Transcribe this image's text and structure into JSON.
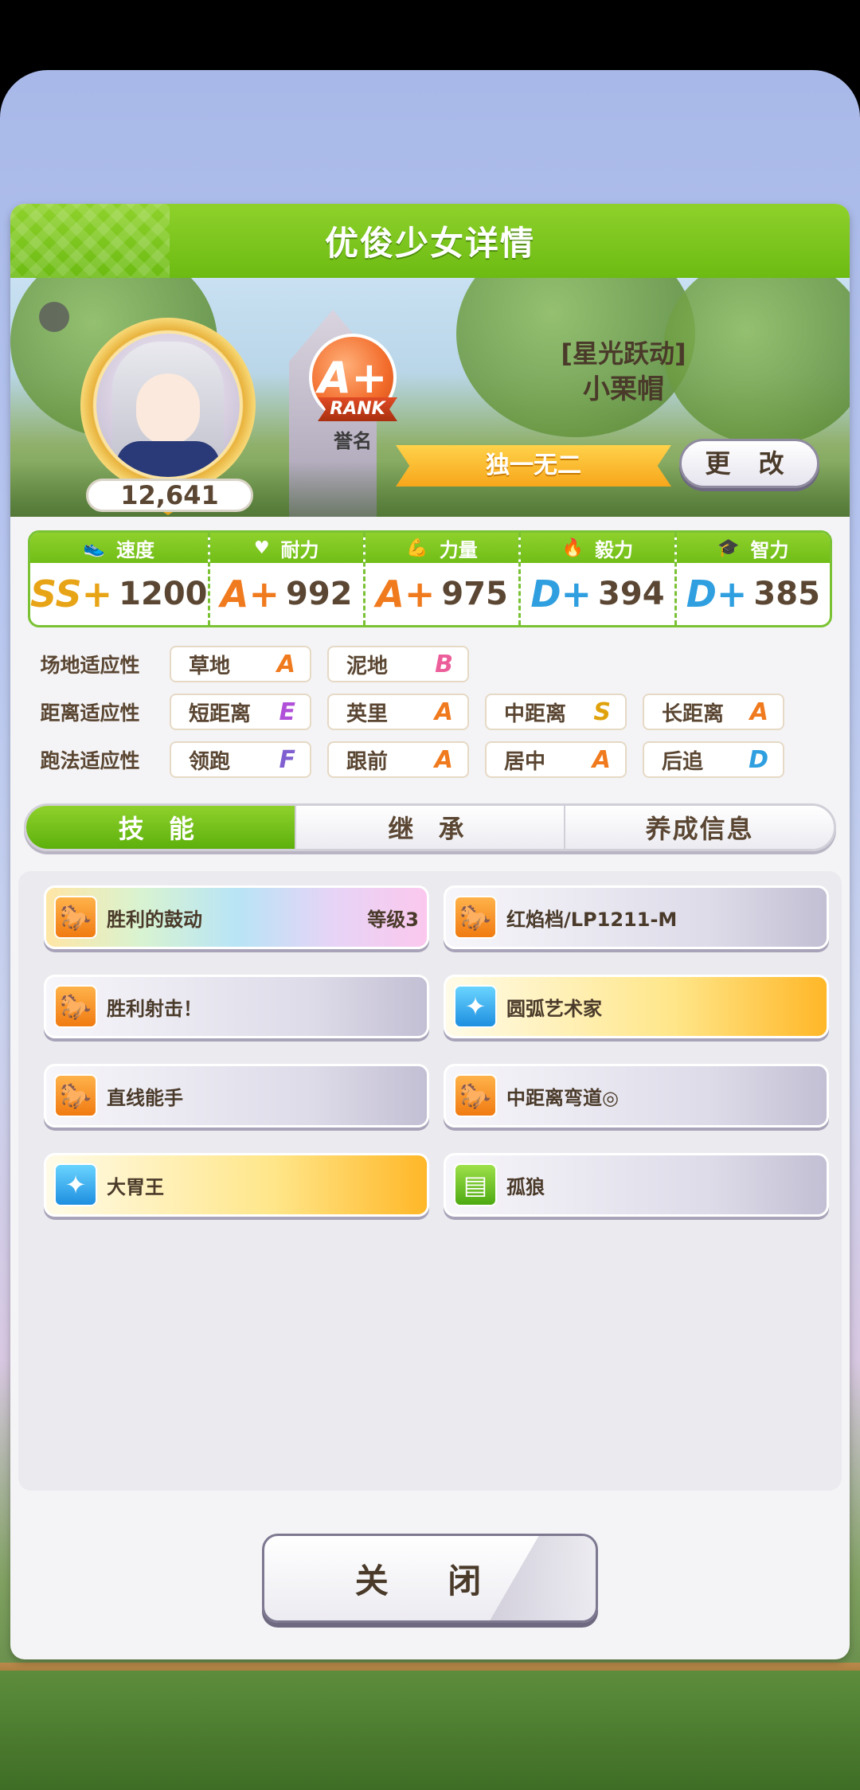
{
  "window": {
    "title": "优俊少女详情"
  },
  "profile": {
    "fan_points": "12,641",
    "rank_grade": "A+",
    "rank_text": "RANK",
    "rank_label": "誉名",
    "title_bracket": "[星光跃动]",
    "name": "小栗帽",
    "title_badge": "独一无二",
    "change_button": "更 改"
  },
  "stats": [
    {
      "label": "速度",
      "icon": "shoe-icon",
      "grade": "SS+",
      "value": "1200",
      "grade_color": "#e8a417"
    },
    {
      "label": "耐力",
      "icon": "heart-icon",
      "grade": "A+",
      "value": "992",
      "grade_color": "#f07a1e"
    },
    {
      "label": "力量",
      "icon": "muscle-icon",
      "grade": "A+",
      "value": "975",
      "grade_color": "#f07a1e"
    },
    {
      "label": "毅力",
      "icon": "flame-icon",
      "grade": "D+",
      "value": "394",
      "grade_color": "#2f9fe0"
    },
    {
      "label": "智力",
      "icon": "graduation-cap-icon",
      "grade": "D+",
      "value": "385",
      "grade_color": "#2f9fe0"
    }
  ],
  "aptitude": {
    "track": {
      "label": "场地适应性",
      "cells": [
        {
          "name": "草地",
          "grade": "A",
          "color": "#f07a1e"
        },
        {
          "name": "泥地",
          "grade": "B",
          "color": "#ec5e9a"
        }
      ]
    },
    "distance": {
      "label": "距离适应性",
      "cells": [
        {
          "name": "短距离",
          "grade": "E",
          "color": "#b050d8"
        },
        {
          "name": "英里",
          "grade": "A",
          "color": "#f07a1e"
        },
        {
          "name": "中距离",
          "grade": "S",
          "color": "#e0a20c"
        },
        {
          "name": "长距离",
          "grade": "A",
          "color": "#f07a1e"
        }
      ]
    },
    "style": {
      "label": "跑法适应性",
      "cells": [
        {
          "name": "领跑",
          "grade": "F",
          "color": "#8060d0"
        },
        {
          "name": "跟前",
          "grade": "A",
          "color": "#f07a1e"
        },
        {
          "name": "居中",
          "grade": "A",
          "color": "#f07a1e"
        },
        {
          "name": "后追",
          "grade": "D",
          "color": "#2f9fe0"
        }
      ]
    }
  },
  "tabs": [
    {
      "label": "技 能",
      "active": true
    },
    {
      "label": "继 承",
      "active": false
    },
    {
      "label": "养成信息",
      "active": false
    }
  ],
  "skills": [
    {
      "name": "胜利的鼓动",
      "level": "等级3",
      "style": "rainbow",
      "icon": "horse-rearing-icon",
      "icon_color": "orange"
    },
    {
      "name": "红焰档/LP1211-M",
      "level": "",
      "style": "normal",
      "icon": "horse-rearing-icon",
      "icon_color": "orange"
    },
    {
      "name": "胜利射击！",
      "level": "",
      "style": "normal",
      "icon": "horse-rearing-icon",
      "icon_color": "orange"
    },
    {
      "name": "圆弧艺术家",
      "level": "",
      "style": "gold",
      "icon": "sparkle-icon",
      "icon_color": "blue"
    },
    {
      "name": "直线能手",
      "level": "",
      "style": "normal",
      "icon": "horse-rearing-icon",
      "icon_color": "orange"
    },
    {
      "name": "中距离弯道◎",
      "level": "",
      "style": "normal",
      "icon": "horse-rearing-icon",
      "icon_color": "orange"
    },
    {
      "name": "大胃王",
      "level": "",
      "style": "gold",
      "icon": "sparkle-icon",
      "icon_color": "blue"
    },
    {
      "name": "孤狼",
      "level": "",
      "style": "normal",
      "icon": "stairs-icon",
      "icon_color": "green"
    }
  ],
  "close_button": "关 闭"
}
